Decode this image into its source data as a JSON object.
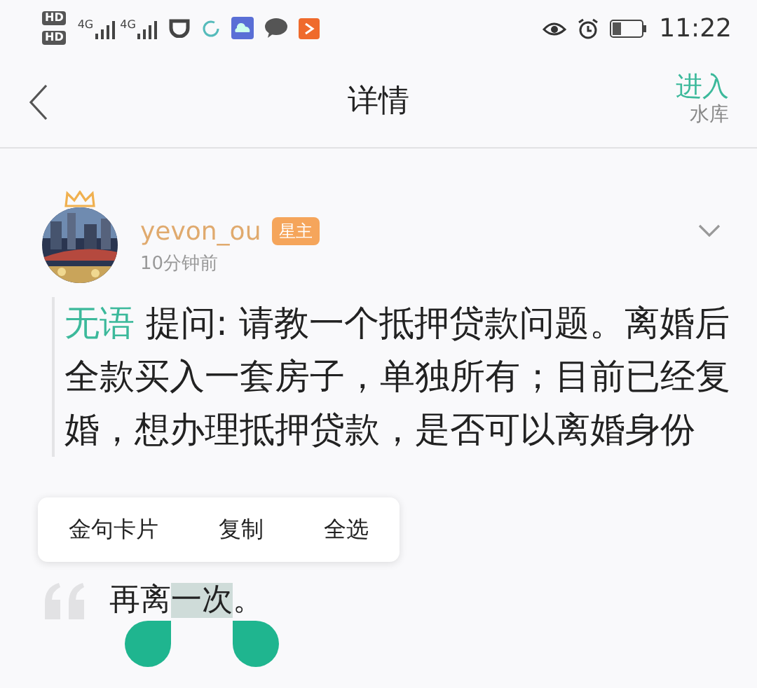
{
  "status_bar": {
    "sim_labels": [
      "HD",
      "HD"
    ],
    "networks": [
      "4G",
      "4G"
    ],
    "time": "11:22"
  },
  "header": {
    "title": "详情",
    "action": "进入",
    "action_sub": "水库"
  },
  "post": {
    "author": "yevon_ou",
    "badge": "星主",
    "time": "10分钟前",
    "question": {
      "asker": "无语",
      "text": "提问: 请教一个抵押贷款问题。离婚后全款买入一套房子，单独所有；目前已经复婚，想办理抵押贷款，是否可以离婚身份"
    },
    "answer": [
      {
        "text": "再离",
        "selected": false
      },
      {
        "text": "一次",
        "selected": true
      },
      {
        "text": "。",
        "selected": false
      }
    ]
  },
  "context_menu": [
    "金句卡片",
    "复制",
    "全选"
  ]
}
